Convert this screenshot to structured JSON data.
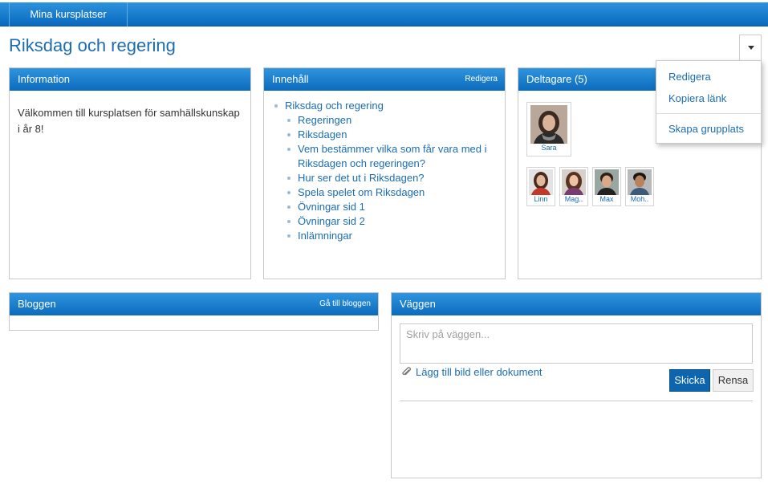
{
  "nav": {
    "tab_label": "Mina kursplatser"
  },
  "page": {
    "title": "Riksdag och regering"
  },
  "dropdown": {
    "items": [
      "Redigera",
      "Kopiera länk",
      "Skapa grupplats"
    ]
  },
  "information": {
    "title": "Information",
    "text": "Välkommen till kursplatsen för samhällskunskap i år 8!"
  },
  "content": {
    "title": "Innehåll",
    "action": "Redigera",
    "root": "Riksdag och regering",
    "items": [
      "Regeringen",
      "Riksdagen",
      "Vem bestämmer vilka som får vara med i Riksdagen och regeringen?",
      "Hur ser det ut i Riksdagen?",
      "Spela spelet om Riksdagen",
      "Övningar sid 1",
      "Övningar sid 2",
      "Inlämningar"
    ]
  },
  "participants": {
    "title": "Deltagare (5)",
    "teacher": "Sara",
    "members": [
      "Linn",
      "Mag..",
      "Max",
      "Moh.."
    ]
  },
  "blog": {
    "title": "Bloggen",
    "action": "Gå till bloggen"
  },
  "wall": {
    "title": "Väggen",
    "placeholder": "Skriv på väggen...",
    "attach_label": "Lägg till bild eller dokument",
    "send_label": "Skicka",
    "clear_label": "Rensa"
  },
  "colors": {
    "accent": "#0b6abd",
    "link": "#1b6db3"
  }
}
